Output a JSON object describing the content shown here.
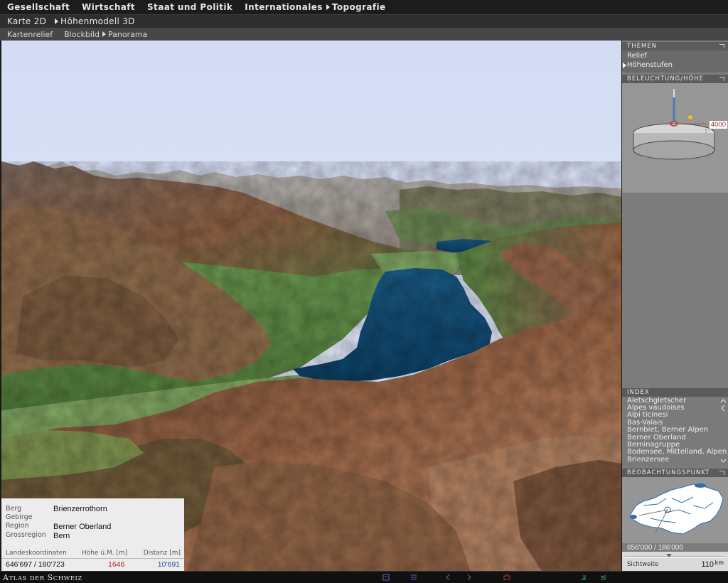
{
  "nav": {
    "primary": [
      "Gesellschaft",
      "Wirtschaft",
      "Staat und Politik",
      "Internationales",
      "Topografie"
    ],
    "secondary": [
      "Karte 2D",
      "Höhenmodell 3D"
    ],
    "tertiary": [
      "Kartenrelief",
      "Blockbild",
      "Panorama"
    ]
  },
  "info": {
    "labels": {
      "berg": "Berg",
      "gebirge": "Gebirge",
      "region": "Region",
      "grossregion": "Grossregion"
    },
    "values": {
      "berg": "Brienzerrothorn",
      "gebirge": "",
      "region": "Berner Oberland",
      "grossregion": "Bern"
    },
    "headers": {
      "coords": "Landeskoordinaten",
      "height": "Höhe ü.M. [m]",
      "distance": "Distanz [m]"
    },
    "coords": "646'697 / 180'723",
    "height": "1646",
    "distance": "10'691",
    "height_color": "#b22222",
    "distance_color": "#1f4f9a"
  },
  "panel": {
    "themen_title": "THEMEN",
    "themes": [
      "Relief",
      "Höhenstufen"
    ],
    "active_theme": "Höhenstufen",
    "light_title": "BELEUCHTUNG/HÖHE",
    "light_value": "4000",
    "index_title": "INDEX",
    "index_items": [
      "Aletschgletscher",
      "Alpes vaudoises",
      "Alpi ticinesi",
      "Bas-Valais",
      "Bernbiet, Berner Alpen",
      "Berner Oberland",
      "Berninagruppe",
      "Bodensee, Mittelland, Alpen",
      "Brienzersee"
    ],
    "obs_title": "BEOBACHTUNGSPUNKT",
    "obs_coords": "656'000 / 186'000",
    "sicht_label": "Sichtweite",
    "sicht_value": "110",
    "sicht_unit": "km"
  },
  "footer": {
    "brand_first_initial": "A",
    "brand_first_rest": "TLAS",
    "brand_mid": "DER",
    "brand_last_initial": "S",
    "brand_last_rest": "CHWEIZ"
  },
  "colors": {
    "sky": "#d6dff5",
    "lake": "#0e4a72",
    "green": "#6f9a52",
    "brown": "#8a5a3c",
    "panel_bg": "#7c7c7c"
  },
  "icons": [
    "legend-icon",
    "list-icon",
    "back-icon",
    "forward-icon",
    "print-icon",
    "help-icon",
    "close-icon"
  ]
}
